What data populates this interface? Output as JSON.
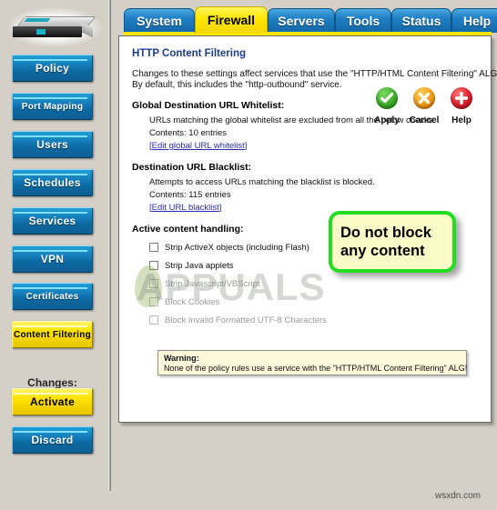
{
  "window": {
    "background_color": "#d4d0c8",
    "footer_text": "wsxdn.com"
  },
  "sidebar": {
    "device_image_name": "router-device-photo",
    "items": [
      {
        "label": "Policy",
        "active": false
      },
      {
        "label": "Port Mapping",
        "active": false
      },
      {
        "label": "Users",
        "active": false
      },
      {
        "label": "Schedules",
        "active": false
      },
      {
        "label": "Services",
        "active": false
      },
      {
        "label": "VPN",
        "active": false
      },
      {
        "label": "Certificates",
        "active": false
      },
      {
        "label": "Content Filtering",
        "active": true
      }
    ],
    "changes_label": "Changes:",
    "changes_buttons": [
      {
        "label": "Activate",
        "style": "yellow"
      },
      {
        "label": "Discard",
        "style": "blue"
      }
    ]
  },
  "tabs": [
    {
      "label": "System",
      "active": false
    },
    {
      "label": "Firewall",
      "active": true
    },
    {
      "label": "Servers",
      "active": false
    },
    {
      "label": "Tools",
      "active": false
    },
    {
      "label": "Status",
      "active": false
    },
    {
      "label": "Help",
      "active": false
    }
  ],
  "content": {
    "title": "HTTP Content Filtering",
    "intro_line1": "Changes to these settings affect services that use the \"HTTP/HTML Content Filtering\" ALG.",
    "intro_line2": "By default, this includes the \"http-outbound\" service.",
    "whitelist": {
      "heading": "Global Destination URL Whitelist:",
      "description": "URLs matching the global whitelist are excluded from all the below checks.",
      "contents": "Contents: 10 entries",
      "link_open": "[",
      "link_text": "Edit global URL whitelist",
      "link_close": "]"
    },
    "blacklist": {
      "heading": "Destination URL Blacklist:",
      "description": "Attempts to access URLs matching the blacklist is blocked.",
      "contents": "Contents: 115 entries",
      "link_open": "[",
      "link_text": "Edit URL blacklist",
      "link_close": "]"
    },
    "active_content": {
      "heading": "Active content handling:",
      "options": [
        {
          "label": "Strip ActiveX objects (including Flash)",
          "checked": false,
          "disabled": false
        },
        {
          "label": "Strip Java applets",
          "checked": false,
          "disabled": false
        },
        {
          "label": "Strip Javascript/VBScript",
          "checked": false,
          "disabled": true
        },
        {
          "label": "Block Cookies",
          "checked": false,
          "disabled": true
        },
        {
          "label": "Block Invalid Formatted UTF-8 Characters",
          "checked": false,
          "disabled": true
        }
      ]
    },
    "warning": {
      "title": "Warning:",
      "text": "None of the policy rules use a service with the \"HTTP/HTML Content Filtering\" ALG!"
    },
    "actions": [
      {
        "label": "Apply",
        "icon": "check-circle-icon",
        "color": "#3fae2a"
      },
      {
        "label": "Cancel",
        "icon": "x-circle-icon",
        "color": "#f09a18"
      },
      {
        "label": "Help",
        "icon": "plus-circle-icon",
        "color": "#d81f2c"
      }
    ]
  },
  "callout": {
    "line1": "Do not block",
    "line2": "any content",
    "border_color": "#22dd22",
    "fill_color": "#fbfbc8"
  },
  "watermark": {
    "text": "APPUALS"
  }
}
